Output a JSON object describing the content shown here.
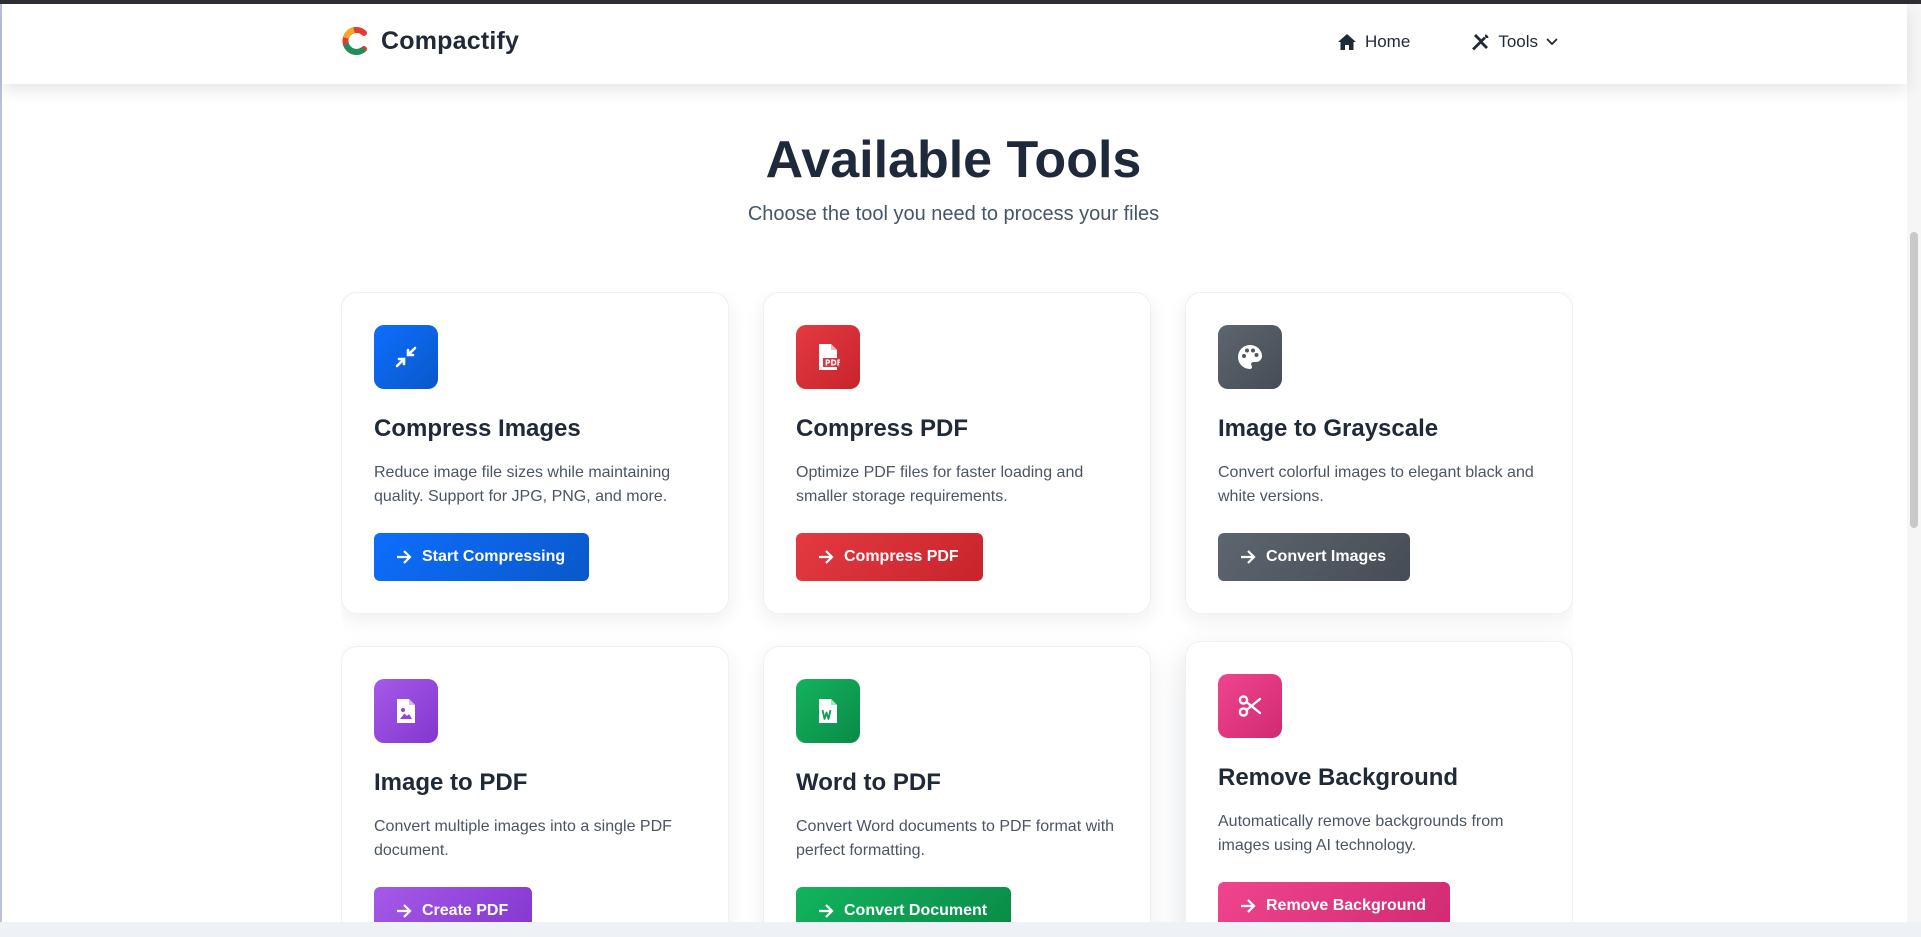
{
  "header": {
    "brand_name": "Compactify",
    "nav": [
      {
        "label": "Home",
        "icon": "home-icon"
      },
      {
        "label": "Tools",
        "icon": "tools-icon",
        "dropdown_icon": "chevron-down-icon"
      }
    ]
  },
  "main": {
    "title": "Available Tools",
    "subtitle": "Choose the tool you need to process your files"
  },
  "tools": [
    {
      "title": "Compress Images",
      "description": "Reduce image file sizes while maintaining quality. Support for JPG, PNG, and more.",
      "button_label": "Start Compressing",
      "icon": "compress-arrows-icon",
      "color": "#0d6efd"
    },
    {
      "title": "Compress PDF",
      "description": "Optimize PDF files for faster loading and smaller storage requirements.",
      "button_label": "Compress PDF",
      "icon": "pdf-file-icon",
      "color": "#dc3545"
    },
    {
      "title": "Image to Grayscale",
      "description": "Convert colorful images to elegant black and white versions.",
      "button_label": "Convert Images",
      "icon": "palette-icon",
      "color": "#4f5761"
    },
    {
      "title": "Image to PDF",
      "description": "Convert multiple images into a single PDF document.",
      "button_label": "Create PDF",
      "icon": "image-file-icon",
      "color": "#9241dc"
    },
    {
      "title": "Word to PDF",
      "description": "Convert Word documents to PDF format with perfect formatting.",
      "button_label": "Convert Document",
      "icon": "word-file-icon",
      "color": "#0f9d58"
    },
    {
      "title": "Remove Background",
      "description": "Automatically remove backgrounds from images using AI technology.",
      "button_label": "Remove Background",
      "icon": "scissors-icon",
      "color": "#e0357e"
    }
  ]
}
